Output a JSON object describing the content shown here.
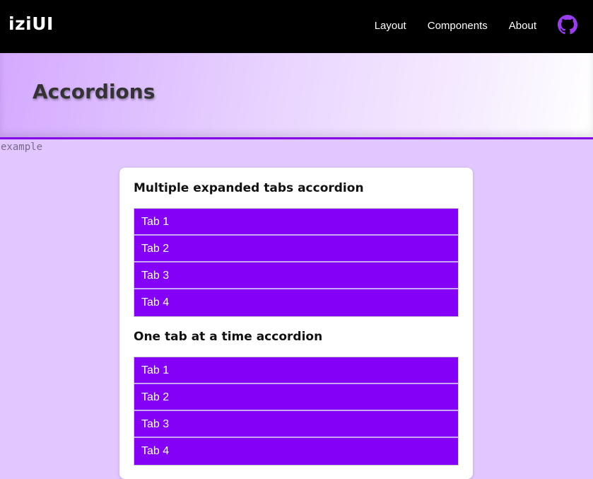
{
  "header": {
    "brand": "iziUI",
    "nav": [
      {
        "label": "Layout"
      },
      {
        "label": "Components"
      },
      {
        "label": "About"
      }
    ],
    "github_icon": "github-icon"
  },
  "hero": {
    "title": "Accordions"
  },
  "example_label": "example",
  "sections": [
    {
      "title": "Multiple expanded tabs accordion",
      "tabs": [
        {
          "label": "Tab 1"
        },
        {
          "label": "Tab 2"
        },
        {
          "label": "Tab 3"
        },
        {
          "label": "Tab 4"
        }
      ]
    },
    {
      "title": "One tab at a time accordion",
      "tabs": [
        {
          "label": "Tab 1"
        },
        {
          "label": "Tab 2"
        },
        {
          "label": "Tab 3"
        },
        {
          "label": "Tab 4"
        }
      ]
    }
  ],
  "colors": {
    "header_bg": "#000000",
    "accent": "#8400f6",
    "page_bg": "#e2c6ff"
  }
}
